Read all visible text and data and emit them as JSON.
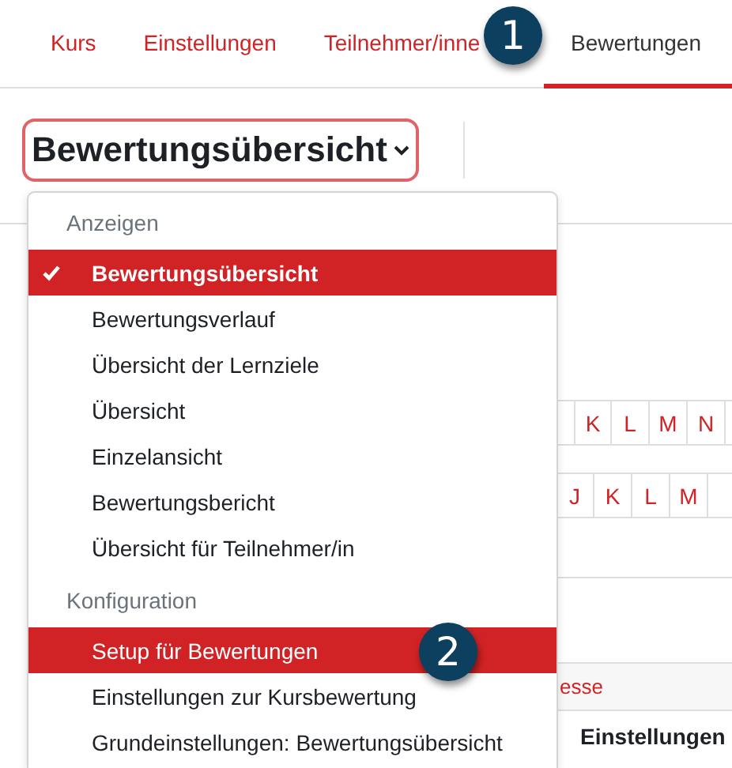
{
  "tabs": [
    {
      "label": "Kurs",
      "selected": false
    },
    {
      "label": "Einstellungen",
      "selected": false
    },
    {
      "label": "Teilnehmer/inne",
      "selected": false
    },
    {
      "label": "Bewertungen",
      "selected": true
    }
  ],
  "report_selector": {
    "label": "Bewertungsübersicht",
    "focused": true,
    "expanded": true
  },
  "menu": {
    "groups": [
      {
        "heading": "Anzeigen",
        "items": [
          {
            "label": "Bewertungsübersicht",
            "selected": true,
            "highlighted": true
          },
          {
            "label": "Bewertungsverlauf",
            "selected": false,
            "highlighted": false
          },
          {
            "label": "Übersicht der Lernziele",
            "selected": false,
            "highlighted": false
          },
          {
            "label": "Übersicht",
            "selected": false,
            "highlighted": false
          },
          {
            "label": "Einzelansicht",
            "selected": false,
            "highlighted": false
          },
          {
            "label": "Bewertungsbericht",
            "selected": false,
            "highlighted": false
          },
          {
            "label": "Übersicht für Teilnehmer/in",
            "selected": false,
            "highlighted": false
          }
        ]
      },
      {
        "heading": "Konfiguration",
        "items": [
          {
            "label": "Setup für Bewertungen",
            "selected": false,
            "highlighted": true
          },
          {
            "label": "Einstellungen zur Kursbewertung",
            "selected": false,
            "highlighted": false
          },
          {
            "label": "Grundeinstellungen: Bewertungsübersicht",
            "selected": false,
            "highlighted": false
          }
        ]
      }
    ]
  },
  "letter_filters": [
    {
      "letters": [
        "K",
        "L",
        "M",
        "N"
      ]
    },
    {
      "letters": [
        "J",
        "K",
        "L",
        "M"
      ]
    }
  ],
  "table": {
    "link_text": "esse",
    "column_heading": "Einstellungen"
  },
  "callouts": [
    {
      "number": "1"
    },
    {
      "number": "2"
    }
  ]
}
